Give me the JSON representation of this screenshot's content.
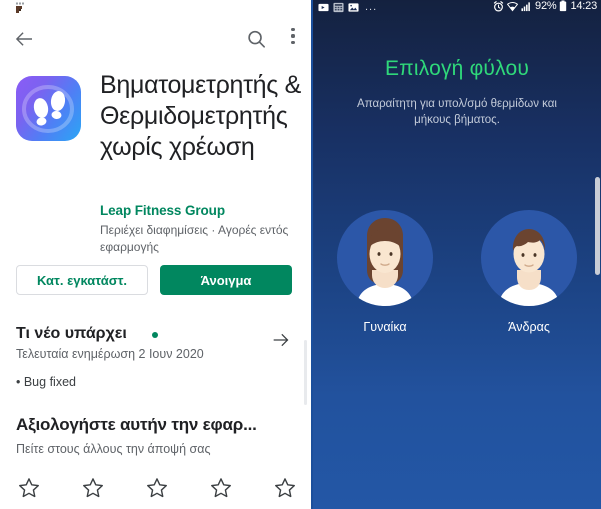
{
  "left_panel": {
    "appbar": {
      "back_icon": "back-arrow-icon",
      "search_icon": "search-icon",
      "overflow_icon": "more-vert-icon"
    },
    "app": {
      "icon_name": "pedometer-app-icon",
      "title": "Βηματομετρητής & Θερμιδομετρητής χωρίς χρέωση",
      "developer": "Leap Fitness Group",
      "meta": "Περιέχει διαφημίσεις  ·  Αγορές εντός εφαρμογής",
      "developer_color": "#01875f"
    },
    "buttons": {
      "uninstall_label": "Κατ. εγκατάστ.",
      "open_label": "Άνοιγμα",
      "open_bg": "#01875f"
    },
    "whats_new": {
      "title": "Τι νέο υπάρχει",
      "badge": "•",
      "subtitle": "Τελευταία ενημέρωση 2 Ιουν 2020",
      "body": "• Bug fixed",
      "arrow_icon": "arrow-right-icon"
    },
    "rate": {
      "title": "Αξιολογήστε αυτήν την εφαρ...",
      "subtitle": "Πείτε στους άλλους την άποψή σας",
      "stars": [
        "1",
        "2",
        "3",
        "4",
        "5"
      ],
      "star_icon": "star-outline-icon"
    }
  },
  "right_panel": {
    "statusbar": {
      "left_icons": [
        "video-icon",
        "calculator-icon",
        "image-icon"
      ],
      "overflow_dots": "...",
      "right_icons": [
        "alarm-icon",
        "wifi-icon",
        "signal-icon",
        "battery-icon"
      ],
      "battery": "92%",
      "time": "14:23"
    },
    "screen": {
      "title": "Επιλογή φύλου",
      "title_color": "#2fd87a",
      "subtitle": "Απαραίτητη για υπολ/σμό θερμίδων και μήκους βήματος.",
      "options": [
        {
          "label": "Γυναίκα",
          "avatar": "female-avatar-icon"
        },
        {
          "label": "Άνδρας",
          "avatar": "male-avatar-icon"
        }
      ]
    }
  }
}
